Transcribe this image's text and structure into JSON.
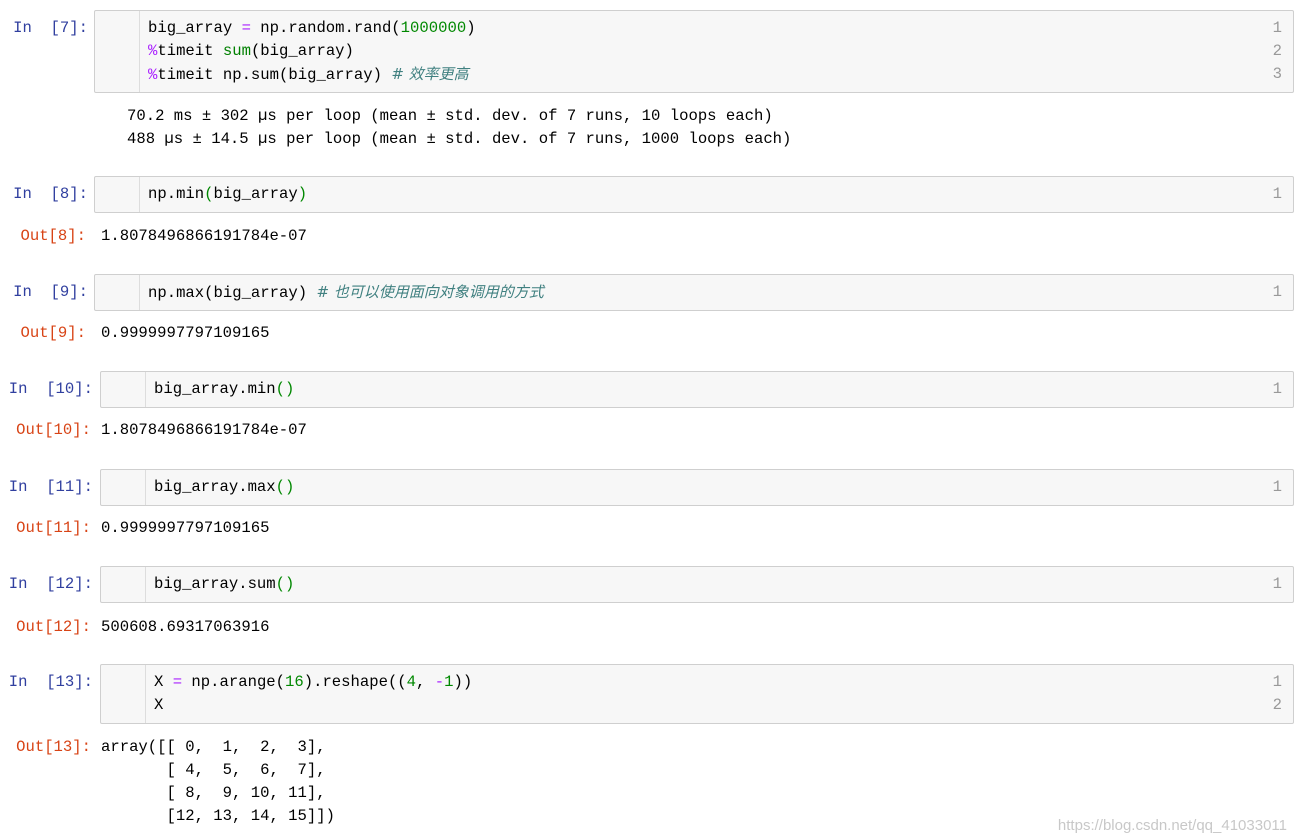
{
  "cells": [
    {
      "prompt": "In  [7]:",
      "lines": [
        [
          {
            "t": "big_array "
          },
          {
            "t": "=",
            "c": "op"
          },
          {
            "t": " np.random.rand("
          },
          {
            "t": "1000000",
            "c": "num"
          },
          {
            "t": ")"
          }
        ],
        [
          {
            "t": "%",
            "c": "op"
          },
          {
            "t": "timeit "
          },
          {
            "t": "sum",
            "c": "bi"
          },
          {
            "t": "(big_array)"
          }
        ],
        [
          {
            "t": "%",
            "c": "op"
          },
          {
            "t": "timeit np.sum(big_array) "
          },
          {
            "t": "# 效率更高",
            "c": "cm"
          }
        ]
      ],
      "out_prompt": "",
      "output": [
        "70.2 ms ± 302 µs per loop (mean ± std. dev. of 7 runs, 10 loops each)",
        "488 µs ± 14.5 µs per loop (mean ± std. dev. of 7 runs, 1000 loops each)"
      ]
    },
    {
      "prompt": "In  [8]:",
      "lines": [
        [
          {
            "t": "np.min"
          },
          {
            "t": "(",
            "c": "num"
          },
          {
            "t": "big_array"
          },
          {
            "t": ")",
            "c": "num"
          }
        ]
      ],
      "out_prompt": "Out[8]:",
      "output": [
        "1.8078496866191784e-07"
      ]
    },
    {
      "prompt": "In  [9]:",
      "lines": [
        [
          {
            "t": "np.max(big_array) "
          },
          {
            "t": "# 也可以使用面向对象调用的方式",
            "c": "cm"
          }
        ]
      ],
      "out_prompt": "Out[9]:",
      "output": [
        "0.9999997797109165"
      ]
    },
    {
      "prompt": "In  [10]:",
      "lines": [
        [
          {
            "t": "big_array.min"
          },
          {
            "t": "()",
            "c": "num"
          }
        ]
      ],
      "out_prompt": "Out[10]:",
      "output": [
        "1.8078496866191784e-07"
      ]
    },
    {
      "prompt": "In  [11]:",
      "lines": [
        [
          {
            "t": "big_array.max"
          },
          {
            "t": "()",
            "c": "num"
          }
        ]
      ],
      "out_prompt": "Out[11]:",
      "output": [
        "0.9999997797109165"
      ]
    },
    {
      "prompt": "In  [12]:",
      "lines": [
        [
          {
            "t": "big_array.sum"
          },
          {
            "t": "()",
            "c": "num"
          }
        ]
      ],
      "out_prompt": "Out[12]:",
      "output": [
        "500608.69317063916"
      ]
    },
    {
      "prompt": "In  [13]:",
      "lines": [
        [
          {
            "t": "X "
          },
          {
            "t": "=",
            "c": "op"
          },
          {
            "t": " np.arange("
          },
          {
            "t": "16",
            "c": "num"
          },
          {
            "t": ").reshape(("
          },
          {
            "t": "4",
            "c": "num"
          },
          {
            "t": ", "
          },
          {
            "t": "-",
            "c": "op"
          },
          {
            "t": "1",
            "c": "num"
          },
          {
            "t": "))"
          }
        ],
        [
          {
            "t": "X"
          }
        ]
      ],
      "out_prompt": "Out[13]:",
      "output": [
        "array([[ 0,  1,  2,  3],",
        "       [ 4,  5,  6,  7],",
        "       [ 8,  9, 10, 11],",
        "       [12, 13, 14, 15]])"
      ]
    }
  ],
  "watermark": "https://blog.csdn.net/qq_41033011",
  "colors": {
    "in_prompt": "#303f9f",
    "out_prompt": "#d84315",
    "keyword_op": "#aa22ff",
    "number": "#008800",
    "comment": "#408080"
  }
}
